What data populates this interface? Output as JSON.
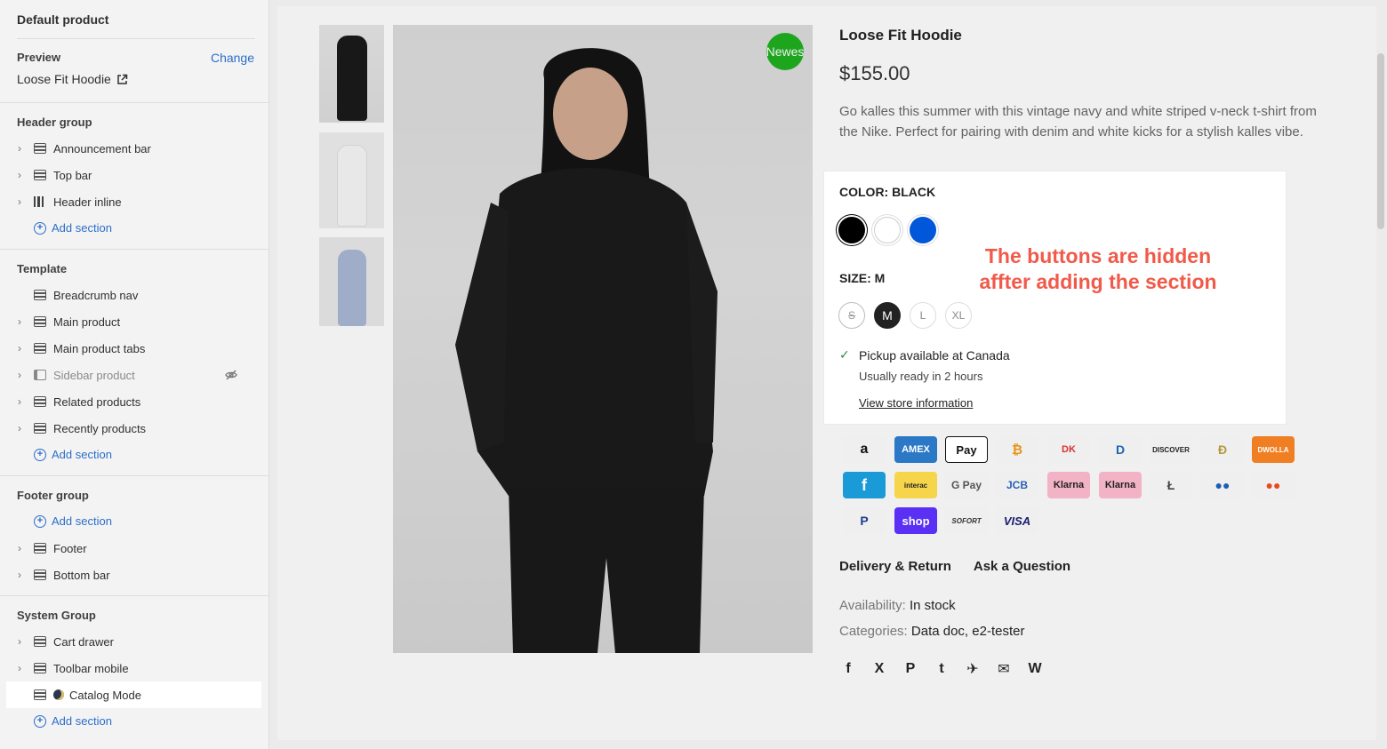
{
  "sidebar": {
    "title": "Default product",
    "preview_label": "Preview",
    "change_label": "Change",
    "preview_product": "Loose Fit Hoodie",
    "add_section_label": "Add section",
    "groups": {
      "header": {
        "label": "Header group",
        "items": [
          "Announcement bar",
          "Top bar",
          "Header inline"
        ]
      },
      "template": {
        "label": "Template",
        "items": [
          "Breadcrumb nav",
          "Main product",
          "Main product tabs",
          "Sidebar product",
          "Related products",
          "Recently products"
        ]
      },
      "footer": {
        "label": "Footer group",
        "items": [
          "Footer",
          "Bottom bar"
        ]
      },
      "system": {
        "label": "System Group",
        "items": [
          "Cart drawer",
          "Toolbar mobile",
          "Catalog Mode"
        ]
      }
    }
  },
  "product": {
    "badge": "Newes",
    "title": "Loose Fit Hoodie",
    "price": "$155.00",
    "description": "Go kalles this summer with this vintage navy and white striped v-neck t-shirt from the Nike. Perfect for pairing with denim and white kicks for a stylish kalles vibe.",
    "color_label": "COLOR: BLACK",
    "colors": [
      "#000000",
      "#ffffff",
      "#0057d9"
    ],
    "size_label": "SIZE: M",
    "sizes": [
      "S",
      "M",
      "L",
      "XL"
    ],
    "pickup_text": "Pickup available at Canada",
    "ready_text": "Usually ready in 2 hours",
    "store_link": "View store information",
    "annotation": "The buttons are hidden affter adding the section",
    "payments": [
      "a",
      "AMEX",
      "Pay",
      "₿",
      "DK",
      "D",
      "DISCOVER",
      "Ð",
      "DWOLLA",
      "f",
      "interac",
      "G Pay",
      "JCB",
      "Klarna",
      "Klarna",
      "Ł",
      "●●",
      "●●",
      "P",
      "shop",
      "SOFORT",
      "VISA"
    ],
    "tab_delivery": "Delivery & Return",
    "tab_question": "Ask a Question",
    "availability_label": "Availability:",
    "availability_value": "In stock",
    "categories_label": "Categories:",
    "categories_value": "Data doc, e2-tester",
    "social": [
      "f",
      "X",
      "P",
      "t",
      "✈",
      "✉",
      "W"
    ]
  }
}
